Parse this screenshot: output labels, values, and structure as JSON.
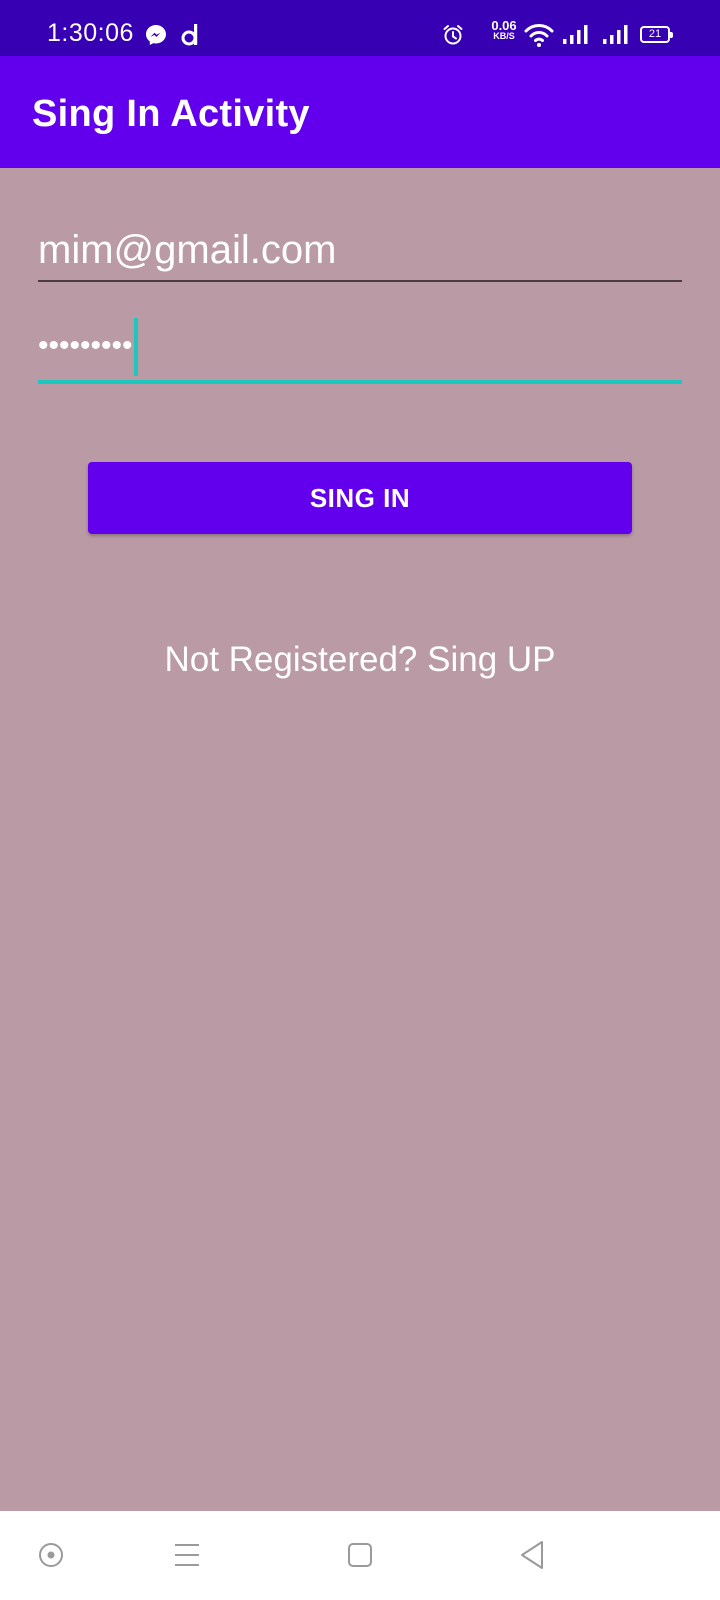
{
  "status_bar": {
    "time": "1:30:06",
    "left_icons": [
      "messenger-icon",
      "d-app-icon"
    ],
    "right_icons": [
      "alarm-icon",
      "wifi-icon",
      "signal-icon",
      "signal-icon",
      "battery-icon"
    ],
    "net_speed_value": "0.06",
    "net_speed_unit": "KB/S",
    "battery_level": "21",
    "background": "#3700B3"
  },
  "app_bar": {
    "title": "Sing In Activity",
    "background": "#6200EE"
  },
  "form": {
    "email_value": "mim@gmail.com",
    "password_masked": "•••••••••",
    "sign_in_button_label": "SING IN",
    "sign_up_link": "Not Registered? Sing UP"
  },
  "theme": {
    "content_background": "#BA9AA4",
    "accent": "#1CC8BD",
    "primary": "#6200EE"
  },
  "nav_bar": {
    "buttons": [
      "assistant-icon",
      "menu-icon",
      "home-icon",
      "back-icon"
    ]
  }
}
